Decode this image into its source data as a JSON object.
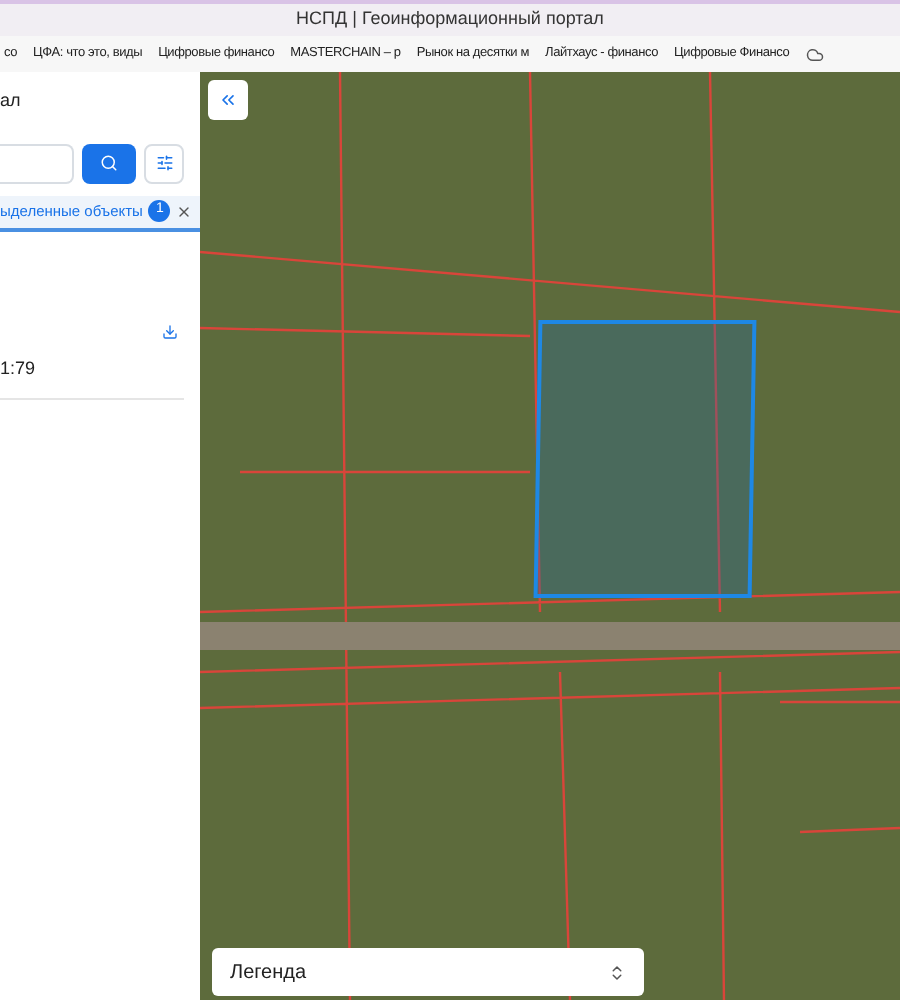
{
  "window": {
    "title": "НСПД | Геоинформационный портал"
  },
  "bookmarks": [
    "со",
    "ЦФА: что это, виды",
    "Цифровые финансо",
    "MASTERCHAIN – р",
    "Рынок на десятки м",
    "Лайтхаус - финансо",
    "Цифровые Финансо"
  ],
  "sidebar": {
    "title": "ал",
    "tab": {
      "label": "ыделенные объекты",
      "badge": "1",
      "selected": true
    },
    "result": {
      "text": "1:79"
    }
  },
  "map": {
    "legend": {
      "label": "Легенда"
    }
  }
}
